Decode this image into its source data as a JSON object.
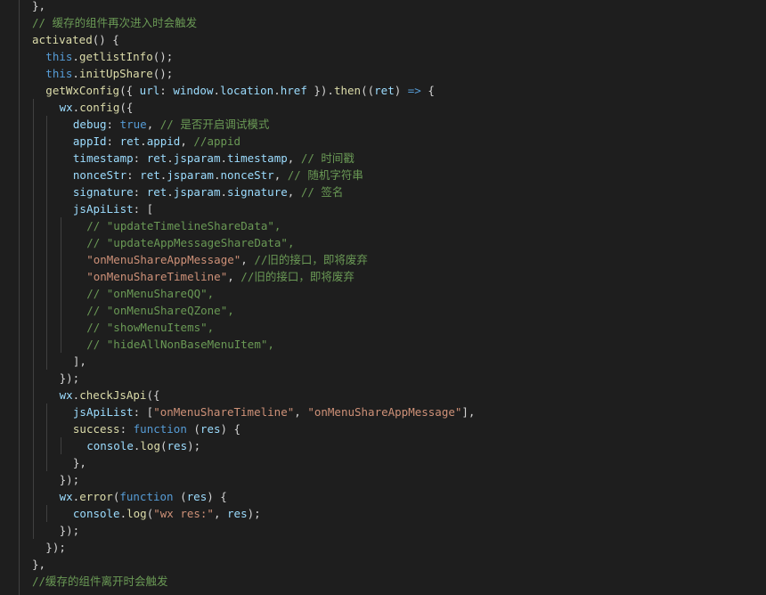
{
  "editor": {
    "theme_colors": {
      "background": "#1e1e1e",
      "keyword": "#569cd6",
      "function": "#dcdcaa",
      "variable": "#9cdcfe",
      "string": "#ce9178",
      "comment": "#6a9955",
      "punctuation": "#d4d4d4",
      "indent_guide": "#404040"
    },
    "lines": [
      {
        "indent": 1,
        "tokens": [
          {
            "t": "},",
            "c": "pun"
          }
        ]
      },
      {
        "indent": 1,
        "tokens": [
          {
            "t": "// 缓存的组件再次进入时会触发",
            "c": "cmt"
          }
        ]
      },
      {
        "indent": 1,
        "tokens": [
          {
            "t": "activated",
            "c": "fn"
          },
          {
            "t": "() {",
            "c": "pun"
          }
        ]
      },
      {
        "indent": 2,
        "tokens": [
          {
            "t": "this",
            "c": "kw"
          },
          {
            "t": ".",
            "c": "pun"
          },
          {
            "t": "getlistInfo",
            "c": "fn"
          },
          {
            "t": "();",
            "c": "pun"
          }
        ]
      },
      {
        "indent": 2,
        "tokens": [
          {
            "t": "this",
            "c": "kw"
          },
          {
            "t": ".",
            "c": "pun"
          },
          {
            "t": "initUpShare",
            "c": "fn"
          },
          {
            "t": "();",
            "c": "pun"
          }
        ]
      },
      {
        "indent": 2,
        "tokens": [
          {
            "t": "getWxConfig",
            "c": "fn"
          },
          {
            "t": "({ ",
            "c": "pun"
          },
          {
            "t": "url",
            "c": "var"
          },
          {
            "t": ": ",
            "c": "pun"
          },
          {
            "t": "window",
            "c": "var"
          },
          {
            "t": ".",
            "c": "pun"
          },
          {
            "t": "location",
            "c": "var"
          },
          {
            "t": ".",
            "c": "pun"
          },
          {
            "t": "href",
            "c": "var"
          },
          {
            "t": " }).",
            "c": "pun"
          },
          {
            "t": "then",
            "c": "fn"
          },
          {
            "t": "((",
            "c": "pun"
          },
          {
            "t": "ret",
            "c": "var"
          },
          {
            "t": ") ",
            "c": "pun"
          },
          {
            "t": "=>",
            "c": "kw"
          },
          {
            "t": " {",
            "c": "pun"
          }
        ]
      },
      {
        "indent": 3,
        "tokens": [
          {
            "t": "wx",
            "c": "var"
          },
          {
            "t": ".",
            "c": "pun"
          },
          {
            "t": "config",
            "c": "fn"
          },
          {
            "t": "({",
            "c": "pun"
          }
        ]
      },
      {
        "indent": 4,
        "tokens": [
          {
            "t": "debug",
            "c": "var"
          },
          {
            "t": ": ",
            "c": "pun"
          },
          {
            "t": "true",
            "c": "kw"
          },
          {
            "t": ", ",
            "c": "pun"
          },
          {
            "t": "// 是否开启调试模式",
            "c": "cmt"
          }
        ]
      },
      {
        "indent": 4,
        "tokens": [
          {
            "t": "appId",
            "c": "var"
          },
          {
            "t": ": ",
            "c": "pun"
          },
          {
            "t": "ret",
            "c": "var"
          },
          {
            "t": ".",
            "c": "pun"
          },
          {
            "t": "appid",
            "c": "var"
          },
          {
            "t": ", ",
            "c": "pun"
          },
          {
            "t": "//appid",
            "c": "cmt"
          }
        ]
      },
      {
        "indent": 4,
        "tokens": [
          {
            "t": "timestamp",
            "c": "var"
          },
          {
            "t": ": ",
            "c": "pun"
          },
          {
            "t": "ret",
            "c": "var"
          },
          {
            "t": ".",
            "c": "pun"
          },
          {
            "t": "jsparam",
            "c": "var"
          },
          {
            "t": ".",
            "c": "pun"
          },
          {
            "t": "timestamp",
            "c": "var"
          },
          {
            "t": ", ",
            "c": "pun"
          },
          {
            "t": "// 时间戳",
            "c": "cmt"
          }
        ]
      },
      {
        "indent": 4,
        "tokens": [
          {
            "t": "nonceStr",
            "c": "var"
          },
          {
            "t": ": ",
            "c": "pun"
          },
          {
            "t": "ret",
            "c": "var"
          },
          {
            "t": ".",
            "c": "pun"
          },
          {
            "t": "jsparam",
            "c": "var"
          },
          {
            "t": ".",
            "c": "pun"
          },
          {
            "t": "nonceStr",
            "c": "var"
          },
          {
            "t": ", ",
            "c": "pun"
          },
          {
            "t": "// 随机字符串",
            "c": "cmt"
          }
        ]
      },
      {
        "indent": 4,
        "tokens": [
          {
            "t": "signature",
            "c": "var"
          },
          {
            "t": ": ",
            "c": "pun"
          },
          {
            "t": "ret",
            "c": "var"
          },
          {
            "t": ".",
            "c": "pun"
          },
          {
            "t": "jsparam",
            "c": "var"
          },
          {
            "t": ".",
            "c": "pun"
          },
          {
            "t": "signature",
            "c": "var"
          },
          {
            "t": ", ",
            "c": "pun"
          },
          {
            "t": "// 签名",
            "c": "cmt"
          }
        ]
      },
      {
        "indent": 4,
        "tokens": [
          {
            "t": "jsApiList",
            "c": "var"
          },
          {
            "t": ": [",
            "c": "pun"
          }
        ]
      },
      {
        "indent": 5,
        "tokens": [
          {
            "t": "// \"updateTimelineShareData\",",
            "c": "cmt"
          }
        ]
      },
      {
        "indent": 5,
        "tokens": [
          {
            "t": "// \"updateAppMessageShareData\",",
            "c": "cmt"
          }
        ]
      },
      {
        "indent": 5,
        "tokens": [
          {
            "t": "\"onMenuShareAppMessage\"",
            "c": "str"
          },
          {
            "t": ", ",
            "c": "pun"
          },
          {
            "t": "//旧的接口，即将废弃",
            "c": "cmt"
          }
        ]
      },
      {
        "indent": 5,
        "tokens": [
          {
            "t": "\"onMenuShareTimeline\"",
            "c": "str"
          },
          {
            "t": ", ",
            "c": "pun"
          },
          {
            "t": "//旧的接口，即将废弃",
            "c": "cmt"
          }
        ]
      },
      {
        "indent": 5,
        "tokens": [
          {
            "t": "// \"onMenuShareQQ\",",
            "c": "cmt"
          }
        ]
      },
      {
        "indent": 5,
        "tokens": [
          {
            "t": "// \"onMenuShareQZone\",",
            "c": "cmt"
          }
        ]
      },
      {
        "indent": 5,
        "tokens": [
          {
            "t": "// \"showMenuItems\",",
            "c": "cmt"
          }
        ]
      },
      {
        "indent": 5,
        "tokens": [
          {
            "t": "// \"hideAllNonBaseMenuItem\",",
            "c": "cmt"
          }
        ]
      },
      {
        "indent": 4,
        "tokens": [
          {
            "t": "],",
            "c": "pun"
          }
        ]
      },
      {
        "indent": 3,
        "tokens": [
          {
            "t": "});",
            "c": "pun"
          }
        ]
      },
      {
        "indent": 3,
        "tokens": [
          {
            "t": "wx",
            "c": "var"
          },
          {
            "t": ".",
            "c": "pun"
          },
          {
            "t": "checkJsApi",
            "c": "fn"
          },
          {
            "t": "({",
            "c": "pun"
          }
        ]
      },
      {
        "indent": 4,
        "tokens": [
          {
            "t": "jsApiList",
            "c": "var"
          },
          {
            "t": ": [",
            "c": "pun"
          },
          {
            "t": "\"onMenuShareTimeline\"",
            "c": "str"
          },
          {
            "t": ", ",
            "c": "pun"
          },
          {
            "t": "\"onMenuShareAppMessage\"",
            "c": "str"
          },
          {
            "t": "],",
            "c": "pun"
          }
        ]
      },
      {
        "indent": 4,
        "tokens": [
          {
            "t": "success",
            "c": "fn"
          },
          {
            "t": ": ",
            "c": "pun"
          },
          {
            "t": "function",
            "c": "kw"
          },
          {
            "t": " (",
            "c": "pun"
          },
          {
            "t": "res",
            "c": "var"
          },
          {
            "t": ") {",
            "c": "pun"
          }
        ]
      },
      {
        "indent": 5,
        "tokens": [
          {
            "t": "console",
            "c": "var"
          },
          {
            "t": ".",
            "c": "pun"
          },
          {
            "t": "log",
            "c": "fn"
          },
          {
            "t": "(",
            "c": "pun"
          },
          {
            "t": "res",
            "c": "var"
          },
          {
            "t": ");",
            "c": "pun"
          }
        ]
      },
      {
        "indent": 4,
        "tokens": [
          {
            "t": "},",
            "c": "pun"
          }
        ]
      },
      {
        "indent": 3,
        "tokens": [
          {
            "t": "});",
            "c": "pun"
          }
        ]
      },
      {
        "indent": 3,
        "tokens": [
          {
            "t": "wx",
            "c": "var"
          },
          {
            "t": ".",
            "c": "pun"
          },
          {
            "t": "error",
            "c": "fn"
          },
          {
            "t": "(",
            "c": "pun"
          },
          {
            "t": "function",
            "c": "kw"
          },
          {
            "t": " (",
            "c": "pun"
          },
          {
            "t": "res",
            "c": "var"
          },
          {
            "t": ") {",
            "c": "pun"
          }
        ]
      },
      {
        "indent": 4,
        "tokens": [
          {
            "t": "console",
            "c": "var"
          },
          {
            "t": ".",
            "c": "pun"
          },
          {
            "t": "log",
            "c": "fn"
          },
          {
            "t": "(",
            "c": "pun"
          },
          {
            "t": "\"wx res:\"",
            "c": "str"
          },
          {
            "t": ", ",
            "c": "pun"
          },
          {
            "t": "res",
            "c": "var"
          },
          {
            "t": ");",
            "c": "pun"
          }
        ]
      },
      {
        "indent": 3,
        "tokens": [
          {
            "t": "});",
            "c": "pun"
          }
        ]
      },
      {
        "indent": 2,
        "tokens": [
          {
            "t": "});",
            "c": "pun"
          }
        ]
      },
      {
        "indent": 1,
        "tokens": [
          {
            "t": "},",
            "c": "pun"
          }
        ]
      },
      {
        "indent": 1,
        "tokens": [
          {
            "t": "//缓存的组件离开时会触发",
            "c": "cmt"
          }
        ]
      }
    ]
  }
}
